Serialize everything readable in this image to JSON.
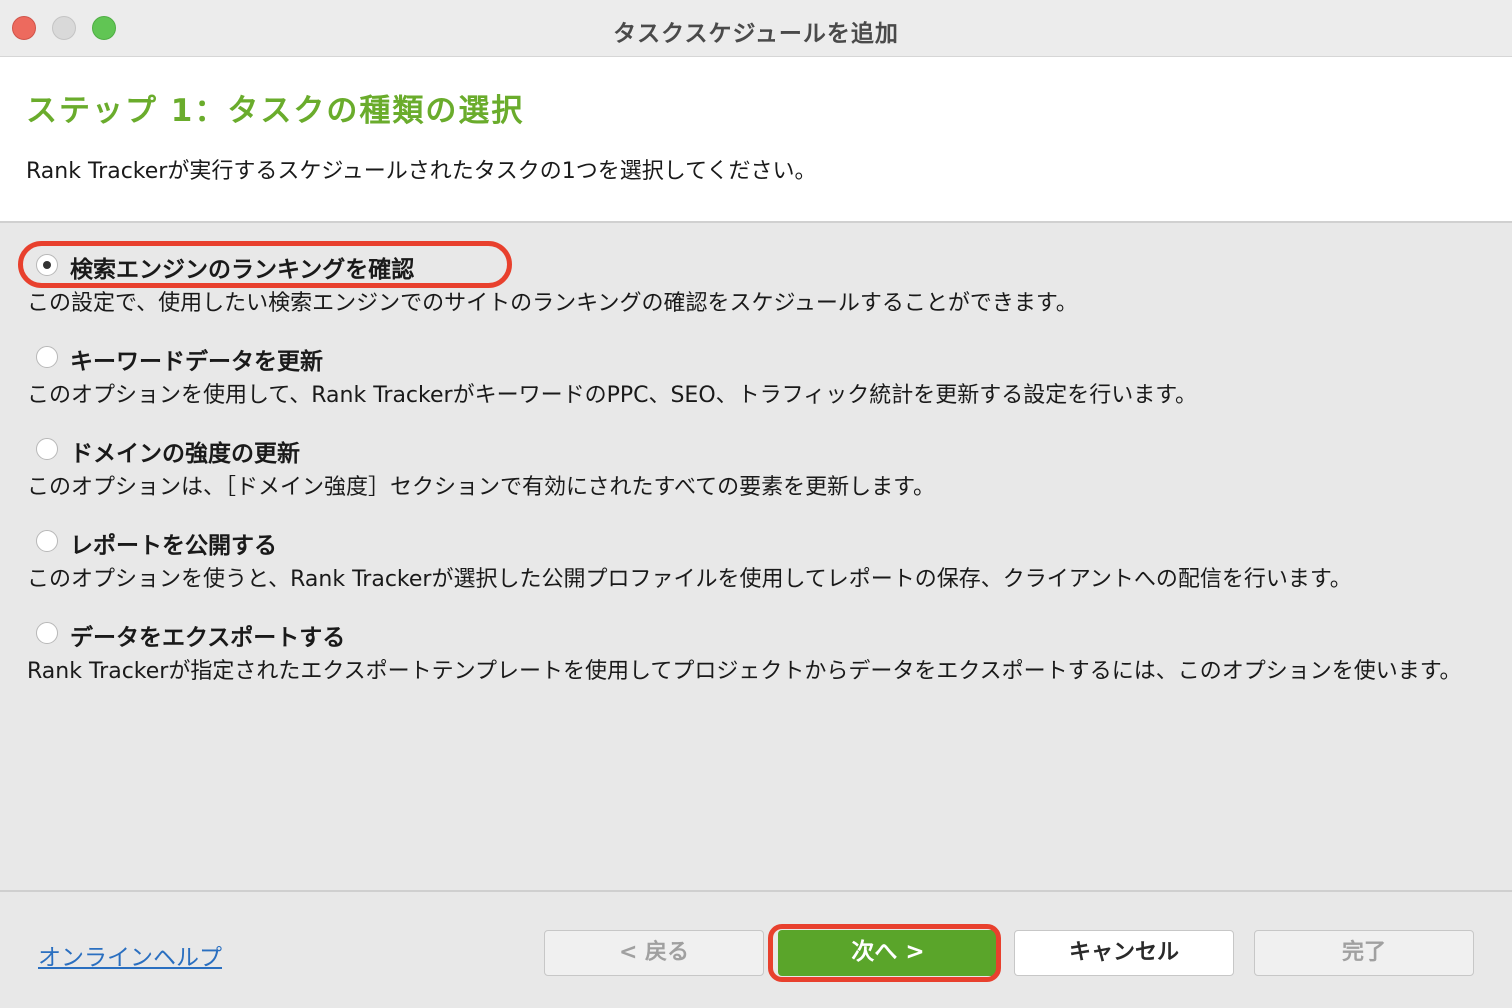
{
  "window": {
    "title": "タスクスケジュールを追加"
  },
  "header": {
    "step_title": "ステップ 1：タスクの種類の選択",
    "description": "Rank Trackerが実行するスケジュールされたタスクの1つを選択してください。"
  },
  "options": [
    {
      "label": "検索エンジンのランキングを確認",
      "selected": true,
      "description": "この設定で、使用したい検索エンジンでのサイトのランキングの確認をスケジュールすることができます。"
    },
    {
      "label": "キーワードデータを更新",
      "selected": false,
      "description": "このオプションを使用して、Rank TrackerがキーワードのPPC、SEO、トラフィック統計を更新する設定を行います。"
    },
    {
      "label": "ドメインの強度の更新",
      "selected": false,
      "description": "このオプションは、［ドメイン強度］セクションで有効にされたすべての要素を更新します。"
    },
    {
      "label": "レポートを公開する",
      "selected": false,
      "description": "このオプションを使うと、Rank Trackerが選択した公開プロファイルを使用してレポートの保存、クライアントへの配信を行います。"
    },
    {
      "label": "データをエクスポートする",
      "selected": false,
      "description": "Rank Trackerが指定されたエクスポートテンプレートを使用してプロジェクトからデータをエクスポートするには、このオプションを使います。"
    }
  ],
  "footer": {
    "help_link": "オンラインヘルプ",
    "back_button": "< 戻る",
    "next_button": "次へ >",
    "cancel_button": "キャンセル",
    "finish_button": "完了"
  },
  "colors": {
    "accent_green": "#6aac2c",
    "primary_button": "#5aa52a",
    "highlight_red": "#e8402d",
    "link_blue": "#2a6fc0"
  }
}
